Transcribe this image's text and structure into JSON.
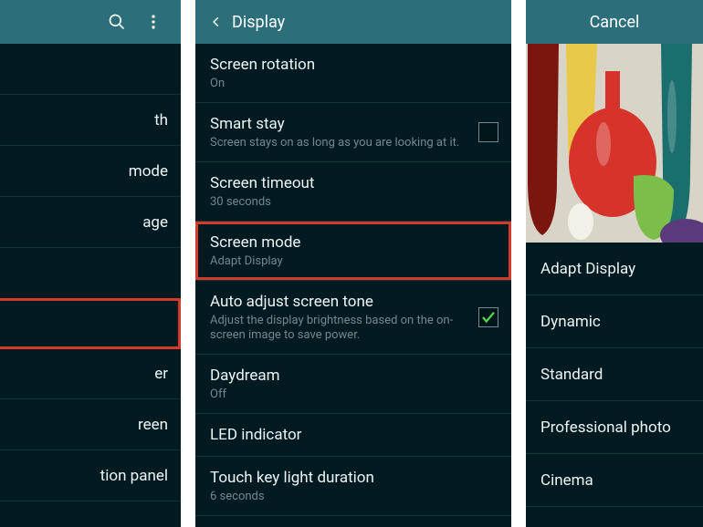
{
  "left": {
    "items": [
      "th",
      "mode",
      "age",
      "",
      "",
      "er",
      "reen",
      "tion panel"
    ]
  },
  "mid": {
    "header": "Display",
    "rows": [
      {
        "title": "Screen rotation",
        "sub": "On"
      },
      {
        "title": "Smart stay",
        "sub": "Screen stays on as long as you are looking at it.",
        "checkbox": true,
        "checked": false
      },
      {
        "title": "Screen timeout",
        "sub": "30 seconds"
      },
      {
        "title": "Screen mode",
        "sub": "Adapt Display",
        "highlight": true
      },
      {
        "title": "Auto adjust screen tone",
        "sub": "Adjust the display brightness based on the on-screen image to save power.",
        "checkbox": true,
        "checked": true
      },
      {
        "title": "Daydream",
        "sub": "Off"
      },
      {
        "title": "LED indicator"
      },
      {
        "title": "Touch key light duration",
        "sub": "6 seconds"
      }
    ]
  },
  "right": {
    "header": "Cancel",
    "options": [
      "Adapt Display",
      "Dynamic",
      "Standard",
      "Professional photo",
      "Cinema"
    ]
  }
}
